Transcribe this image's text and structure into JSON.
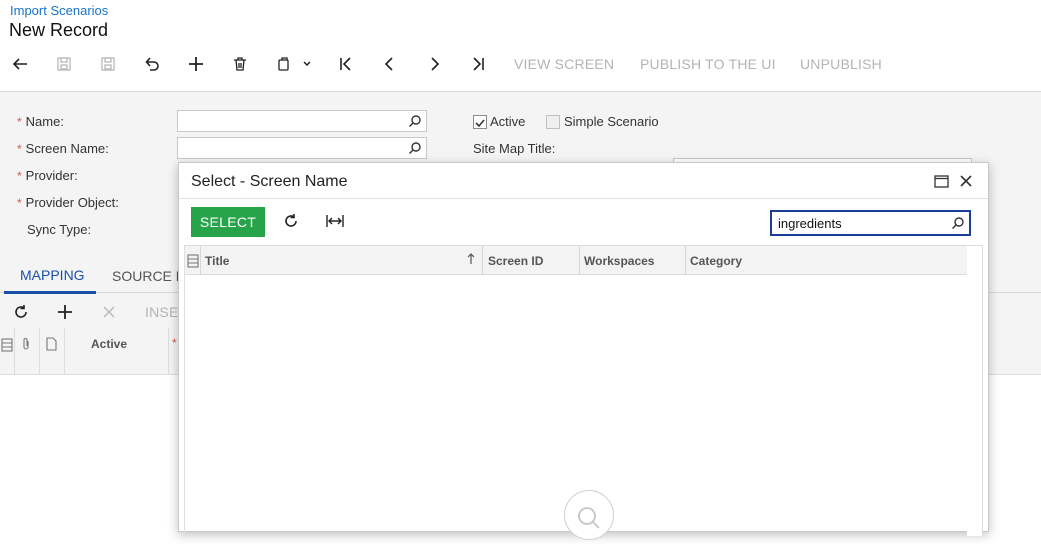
{
  "header": {
    "breadcrumb": "Import Scenarios",
    "title": "New Record"
  },
  "toolbar": {
    "view_screen": "VIEW SCREEN",
    "publish": "PUBLISH TO THE UI",
    "unpublish": "UNPUBLISH"
  },
  "form": {
    "name_label": "Name:",
    "screen_name_label": "Screen Name:",
    "provider_label": "Provider:",
    "provider_object_label": "Provider Object:",
    "sync_type_label": "Sync Type:",
    "required_mark": "*",
    "active_label": "Active",
    "active_checked": true,
    "simple_scenario_label": "Simple Scenario",
    "site_map_title_label": "Site Map Title:"
  },
  "tabs": [
    {
      "label": "MAPPING",
      "active": true
    },
    {
      "label": "SOURCE R",
      "active": false
    }
  ],
  "grid": {
    "insert_label": "INSE",
    "columns": [
      "Active"
    ]
  },
  "dialog": {
    "title": "Select - Screen Name",
    "select_label": "SELECT",
    "search_value": "ingredients",
    "columns": [
      "Title",
      "Screen ID",
      "Workspaces",
      "Category"
    ]
  },
  "colors": {
    "link": "#1a73c4",
    "accent": "#1a4fa8",
    "select_button": "#27a34a",
    "required": "#d9534f"
  }
}
